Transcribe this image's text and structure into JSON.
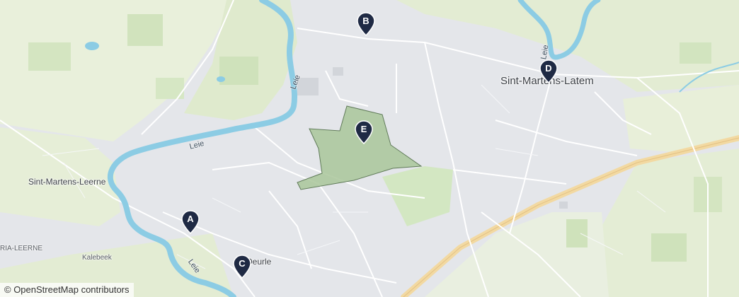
{
  "places": {
    "sint_martens_latem": "Sint-Martens-Latem",
    "sint_martens_leerne": "Sint-Martens-Leerne",
    "deurle": "Deurle",
    "kalebeek": "Kalebeek",
    "leerne_partial": "RIA-LEERNE"
  },
  "rivers": {
    "leie_1": "Leie",
    "leie_2": "Leie",
    "leie_3": "Leie",
    "leie_4": "Leie"
  },
  "markers": [
    {
      "label": "A"
    },
    {
      "label": "B"
    },
    {
      "label": "C"
    },
    {
      "label": "D"
    },
    {
      "label": "E"
    }
  ],
  "attribution": "© OpenStreetMap contributors",
  "colors": {
    "background": "#e4e6ea",
    "farmland": "#e8efd9",
    "meadow": "#d5e6c3",
    "forest": "#c6dcb3",
    "water": "#8ccce4",
    "park": "#a9c59a",
    "motorway": "#f2d9a2",
    "marker": "#1f2a44"
  }
}
